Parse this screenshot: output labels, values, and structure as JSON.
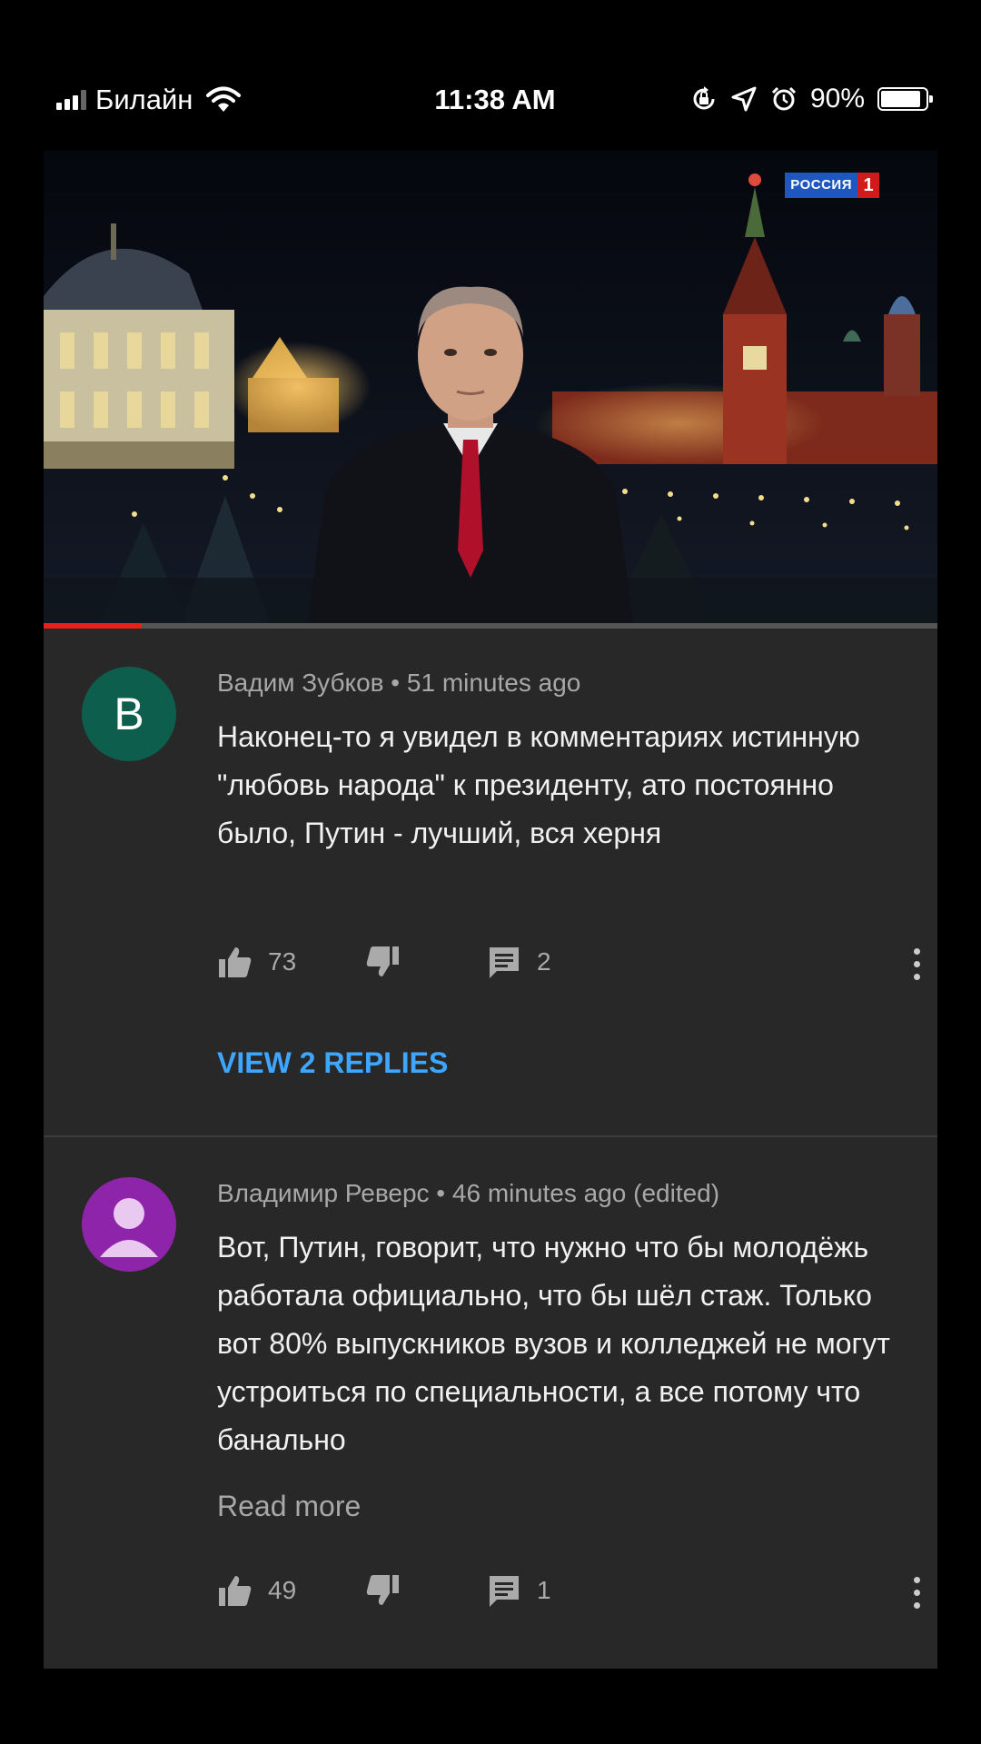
{
  "status_bar": {
    "carrier": "Билайн",
    "time": "11:38 AM",
    "battery": "90%",
    "battery_level": 0.9
  },
  "video": {
    "channel_name": "РОССИЯ",
    "channel_number": "1",
    "progress": 0.11
  },
  "comments": [
    {
      "avatar_letter": "B",
      "author": "Вадим Зубков",
      "time": "51 minutes ago",
      "meta": "Вадим Зубков • 51 minutes ago",
      "text": "Наконец-то я увидел в комментариях истинную \"любовь народа\" к президенту, ато постоянно было, Путин - лучший, вся херня",
      "likes": "73",
      "replies_count": "2",
      "view_replies": "VIEW 2 REPLIES"
    },
    {
      "author": "Владимир Реверс",
      "time": "46 minutes ago",
      "meta": "Владимир Реверс • 46 minutes ago (edited)",
      "text": "Вот, Путин, говорит, что нужно что бы молодёжь работала официально, что бы шёл стаж. Только вот 80% выпускников вузов и колледжей не могут устроиться по специальности, а все потому что банально",
      "read_more": "Read more",
      "likes": "49",
      "replies_count": "1"
    }
  ],
  "icons": {
    "like": "thumbs-up-icon",
    "dislike": "thumbs-down-icon",
    "reply": "comment-icon",
    "more": "more-vert-icon"
  },
  "colors": {
    "panel_bg": "#282828",
    "link": "#3ea6ff",
    "progress": "#e62117",
    "avatar_1": "#0e5e4e",
    "avatar_2": "#8e24aa"
  }
}
